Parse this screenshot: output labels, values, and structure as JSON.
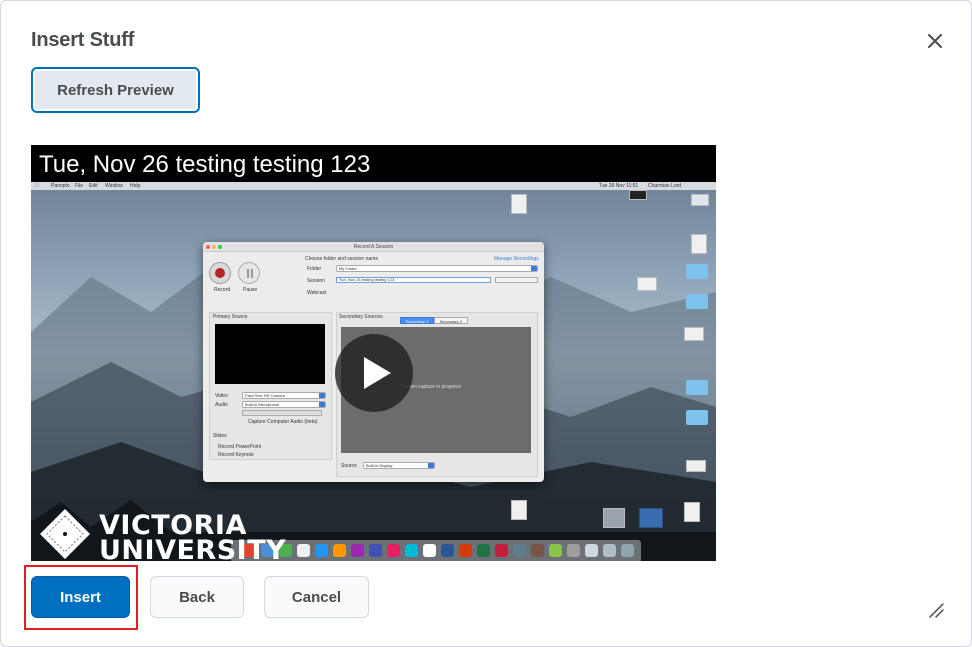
{
  "dialog": {
    "title": "Insert Stuff",
    "close_icon": "close-icon"
  },
  "toolbar": {
    "refresh_label": "Refresh Preview"
  },
  "video": {
    "title": "Tue, Nov 26 testing testing 123",
    "play_icon": "play-icon",
    "watermark": "VICTORIA UNIVERSITY",
    "recorder": {
      "window_title": "Record A Session",
      "choose_label": "Choose folder and session name",
      "manage_link": "Manage Recordings",
      "folder_label": "Folder",
      "folder_value": "My Folder",
      "session_label": "Session",
      "session_value": "Tue, Nov 26 testing testing 123",
      "webcast_label": "Webcast",
      "record_label": "Record",
      "pause_label": "Pause",
      "primary_source": "Primary Source",
      "secondary_sources": "Secondary Sources",
      "tab1": "Secondary 1",
      "tab2": "Secondary 2",
      "video_label": "Video",
      "video_value": "FaceTime HD Camera",
      "audio_label": "Audio",
      "audio_value": "Built-in Microphone",
      "capture_audio": "Capture Computer Audio (beta)",
      "slides_label": "Slides",
      "ppt_label": "Record PowerPoint",
      "keynote_label": "Record Keynote",
      "capture_status": "Screen capture in progress",
      "source_label": "Source",
      "source_value": "Built-in Display"
    }
  },
  "footer": {
    "insert_label": "Insert",
    "back_label": "Back",
    "cancel_label": "Cancel",
    "resize_icon": "resize-handle-icon"
  },
  "colors": {
    "primary": "#006fbf",
    "highlight": "#e0201b",
    "secondary_bg": "#f9fafb",
    "text": "#494c4e"
  }
}
